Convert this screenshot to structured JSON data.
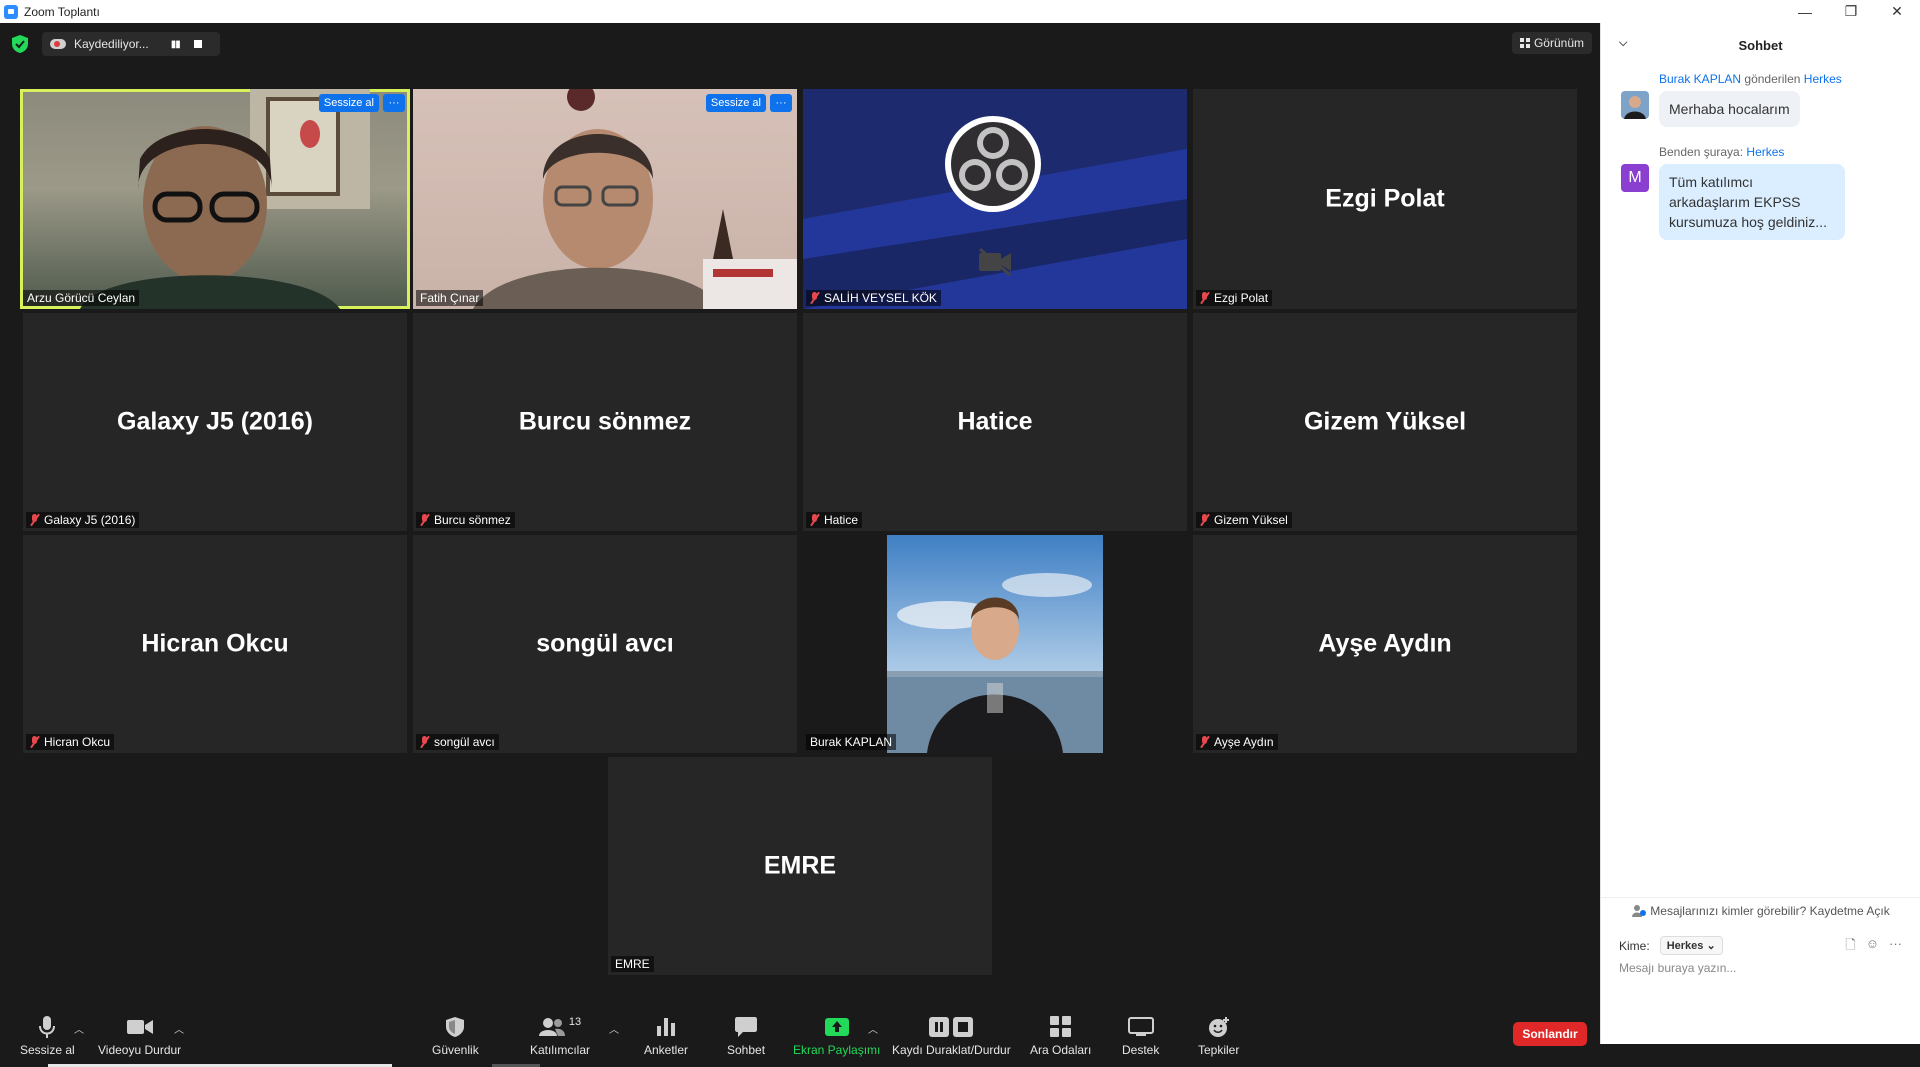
{
  "window": {
    "title": "Zoom Toplantı",
    "controls": [
      "—",
      "❐",
      "✕"
    ]
  },
  "topbar": {
    "recording_status": "Kaydediliyor...",
    "view_label": "Görünüm"
  },
  "participants": [
    {
      "name": "Arzu Görücü Ceylan",
      "video": true,
      "muted": false,
      "active": true,
      "mute_label": "Sessize al",
      "more_label": "···"
    },
    {
      "name": "Fatih Çınar",
      "video": true,
      "muted": false,
      "active": false,
      "mute_label": "Sessize al",
      "more_label": "···"
    },
    {
      "name": "SALİH VEYSEL KÖK",
      "video": false,
      "muted": true,
      "shows_logo": true
    },
    {
      "name": "Ezgi Polat",
      "big_name": "Ezgi Polat",
      "video": false,
      "muted": true
    },
    {
      "name": "Galaxy J5 (2016)",
      "big_name": "Galaxy J5 (2016)",
      "video": false,
      "muted": true
    },
    {
      "name": "Burcu sönmez",
      "big_name": "Burcu sönmez",
      "video": false,
      "muted": true
    },
    {
      "name": "Hatice",
      "big_name": "Hatice",
      "video": false,
      "muted": true
    },
    {
      "name": "Gizem Yüksel",
      "big_name": "Gizem Yüksel",
      "video": false,
      "muted": true
    },
    {
      "name": "Hicran Okcu",
      "big_name": "Hicran Okcu",
      "video": false,
      "muted": true
    },
    {
      "name": "songül avcı",
      "big_name": "songül avcı",
      "video": false,
      "muted": true
    },
    {
      "name": "Burak KAPLAN",
      "video": true,
      "muted": false
    },
    {
      "name": "Ayşe Aydın",
      "big_name": "Ayşe Aydın",
      "video": false,
      "muted": true
    },
    {
      "name": "EMRE",
      "big_name": "EMRE",
      "video": false,
      "muted": false
    }
  ],
  "toolbar": {
    "mute": "Sessize al",
    "video": "Videoyu Durdur",
    "security": "Güvenlik",
    "participants": "Katılımcılar",
    "participant_count": "13",
    "polls": "Anketler",
    "chat": "Sohbet",
    "share": "Ekran Paylaşımı",
    "record": "Kaydı Duraklat/Durdur",
    "breakout": "Ara Odaları",
    "support": "Destek",
    "reactions": "Tepkiler",
    "end": "Sonlandır"
  },
  "chat": {
    "title": "Sohbet",
    "messages": [
      {
        "sender": "Burak KAPLAN",
        "verb": "gönderilen",
        "to": "Herkes",
        "text": "Merhaba hocalarım"
      },
      {
        "sender": "Benden şuraya:",
        "to": "Herkes",
        "avatar_letter": "M",
        "text": "Tüm katılımcı arkadaşlarım EKPSS kursumuza hoş geldiniz..."
      }
    ],
    "privacy_note": "Mesajlarınızı kimler görebilir? Kaydetme Açık",
    "to_label": "Kime:",
    "to_value": "Herkes",
    "input_placeholder": "Mesajı buraya yazın..."
  },
  "colors": {
    "accent": "#0e72ed",
    "end": "#e02828",
    "active_speaker": "#d8f05a",
    "share": "#23d959"
  }
}
